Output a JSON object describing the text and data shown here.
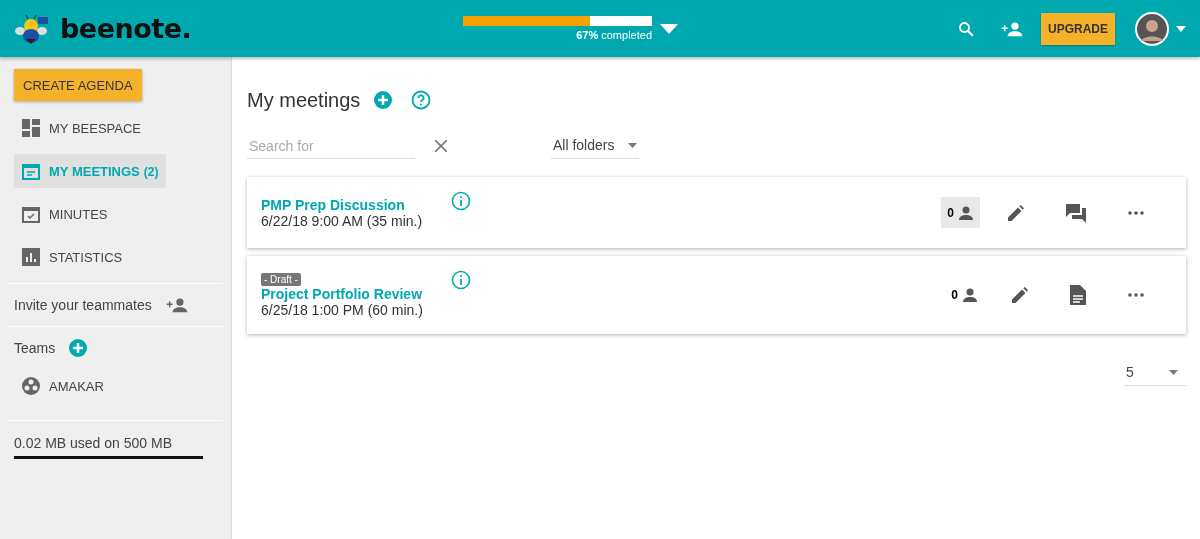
{
  "header": {
    "logo": "beenote.",
    "progress": {
      "level": 0.67,
      "label": "**67%** completed"
    },
    "upgrade": "UPGRADE"
  },
  "sidebar": {
    "create": "CREATE AGENDA",
    "items": [
      {
        "label": "MY BEESPACE",
        "selected": false
      },
      {
        "label": "MY MEETINGS",
        "count": "(2)",
        "selected": true
      },
      {
        "label": "MINUTES",
        "selected": false
      },
      {
        "label": "STATISTICS",
        "selected": false
      }
    ],
    "invite": "Invite your teammates",
    "teams_label": "Teams",
    "teams": [
      "AMAKAR"
    ],
    "storage": "0.02 MB used on 500 MB"
  },
  "main": {
    "title": "My meetings",
    "search": {
      "placeholder": "Search for"
    },
    "folder": "All folders",
    "meetings": [
      {
        "title": "PMP Prep Discussion",
        "when": "6/22/18 9:00 AM (35 min.)",
        "draft": false,
        "participants": "0",
        "participants_highlighted": true,
        "kind": "discussion"
      },
      {
        "badge": "- Draft -",
        "title": "Project Portfolio Review",
        "when": "6/25/18 1:00 PM (60 min.)",
        "draft": true,
        "participants": "0",
        "participants_highlighted": false,
        "kind": "document"
      }
    ],
    "page_size": "5"
  }
}
